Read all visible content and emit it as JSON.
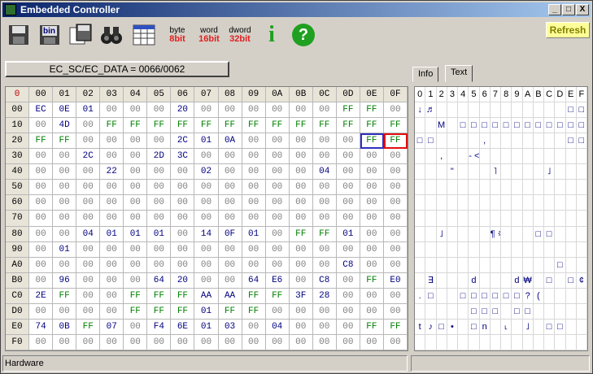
{
  "window": {
    "title": "Embedded Controller",
    "min": "_",
    "max": "□",
    "close": "X"
  },
  "toolbar": {
    "bin": "bin",
    "byte": {
      "top": "byte",
      "bottom": "8bit"
    },
    "word": {
      "top": "word",
      "bottom": "16bit"
    },
    "dword": {
      "top": "dword",
      "bottom": "32bit"
    },
    "info": "i",
    "help": "?",
    "refresh": "Refresh",
    "colors": {
      "byte": "#e02020",
      "word": "#e02020",
      "dword": "#e02020",
      "info": "#20a020",
      "help": "#20a020"
    }
  },
  "ec_label": "EC_SC/EC_DATA = 0066/0062",
  "hex": {
    "corner": "0",
    "cols": [
      "00",
      "01",
      "02",
      "03",
      "04",
      "05",
      "06",
      "07",
      "08",
      "09",
      "0A",
      "0B",
      "0C",
      "0D",
      "0E",
      "0F"
    ],
    "rows": [
      {
        "label": "00",
        "cells": [
          "EC",
          "0E",
          "01",
          "00",
          "00",
          "00",
          "20",
          "00",
          "00",
          "00",
          "00",
          "00",
          "00",
          "FF",
          "FF",
          "00"
        ]
      },
      {
        "label": "10",
        "cells": [
          "00",
          "4D",
          "00",
          "FF",
          "FF",
          "FF",
          "FF",
          "FF",
          "FF",
          "FF",
          "FF",
          "FF",
          "FF",
          "FF",
          "FF",
          "FF"
        ]
      },
      {
        "label": "20",
        "cells": [
          "FF",
          "FF",
          "00",
          "00",
          "00",
          "00",
          "2C",
          "01",
          "0A",
          "00",
          "00",
          "00",
          "00",
          "00",
          "FF",
          "FF"
        ]
      },
      {
        "label": "30",
        "cells": [
          "00",
          "00",
          "2C",
          "00",
          "00",
          "2D",
          "3C",
          "00",
          "00",
          "00",
          "00",
          "00",
          "00",
          "00",
          "00",
          "00"
        ]
      },
      {
        "label": "40",
        "cells": [
          "00",
          "00",
          "00",
          "22",
          "00",
          "00",
          "00",
          "02",
          "00",
          "00",
          "00",
          "00",
          "04",
          "00",
          "00",
          "00"
        ]
      },
      {
        "label": "50",
        "cells": [
          "00",
          "00",
          "00",
          "00",
          "00",
          "00",
          "00",
          "00",
          "00",
          "00",
          "00",
          "00",
          "00",
          "00",
          "00",
          "00"
        ]
      },
      {
        "label": "60",
        "cells": [
          "00",
          "00",
          "00",
          "00",
          "00",
          "00",
          "00",
          "00",
          "00",
          "00",
          "00",
          "00",
          "00",
          "00",
          "00",
          "00"
        ]
      },
      {
        "label": "70",
        "cells": [
          "00",
          "00",
          "00",
          "00",
          "00",
          "00",
          "00",
          "00",
          "00",
          "00",
          "00",
          "00",
          "00",
          "00",
          "00",
          "00"
        ]
      },
      {
        "label": "80",
        "cells": [
          "00",
          "00",
          "04",
          "01",
          "01",
          "01",
          "00",
          "14",
          "0F",
          "01",
          "00",
          "FF",
          "FF",
          "01",
          "00",
          "00"
        ]
      },
      {
        "label": "90",
        "cells": [
          "00",
          "01",
          "00",
          "00",
          "00",
          "00",
          "00",
          "00",
          "00",
          "00",
          "00",
          "00",
          "00",
          "00",
          "00",
          "00"
        ]
      },
      {
        "label": "A0",
        "cells": [
          "00",
          "00",
          "00",
          "00",
          "00",
          "00",
          "00",
          "00",
          "00",
          "00",
          "00",
          "00",
          "00",
          "C8",
          "00",
          "00"
        ]
      },
      {
        "label": "B0",
        "cells": [
          "00",
          "96",
          "00",
          "00",
          "00",
          "64",
          "20",
          "00",
          "00",
          "64",
          "E6",
          "00",
          "C8",
          "00",
          "FF",
          "E0"
        ]
      },
      {
        "label": "C0",
        "cells": [
          "2E",
          "FF",
          "00",
          "00",
          "FF",
          "FF",
          "FF",
          "AA",
          "AA",
          "FF",
          "FF",
          "3F",
          "28",
          "00",
          "00",
          "00"
        ]
      },
      {
        "label": "D0",
        "cells": [
          "00",
          "00",
          "00",
          "00",
          "FF",
          "FF",
          "FF",
          "01",
          "FF",
          "FF",
          "00",
          "00",
          "00",
          "00",
          "00",
          "00"
        ]
      },
      {
        "label": "E0",
        "cells": [
          "74",
          "0B",
          "FF",
          "07",
          "00",
          "F4",
          "6E",
          "01",
          "03",
          "00",
          "04",
          "00",
          "00",
          "00",
          "FF",
          "FF"
        ]
      },
      {
        "label": "F0",
        "cells": [
          "00",
          "00",
          "00",
          "00",
          "00",
          "00",
          "00",
          "00",
          "00",
          "00",
          "00",
          "00",
          "00",
          "00",
          "00",
          "00"
        ]
      }
    ]
  },
  "tabs": [
    {
      "label": "Info"
    },
    {
      "label": "Text"
    }
  ],
  "text": {
    "cols": [
      "0",
      "1",
      "2",
      "3",
      "4",
      "5",
      "6",
      "7",
      "8",
      "9",
      "A",
      "B",
      "C",
      "D",
      "E",
      "F"
    ],
    "rows": [
      [
        "↓",
        "♬",
        "",
        "",
        "",
        "",
        "",
        "",
        "",
        "",
        "",
        "",
        "",
        "",
        "□",
        "□"
      ],
      [
        "",
        "",
        "M",
        "",
        "□",
        "□",
        "□",
        "□",
        "□",
        "□",
        "□",
        "□",
        "□",
        "□",
        "□",
        "□"
      ],
      [
        "□",
        "□",
        "",
        "",
        "",
        "",
        "",
        "",
        "",
        "",
        "",
        "",
        "",
        "",
        "□",
        "□"
      ],
      [
        "",
        "",
        "",
        "",
        "",
        "",
        "",
        "",
        "",
        "",
        "",
        "",
        "",
        "",
        "",
        ""
      ],
      [
        "",
        "",
        "",
        "",
        "",
        "",
        "",
        "",
        "",
        "",
        "",
        "",
        "",
        "",
        "",
        ""
      ],
      [
        "",
        "",
        "",
        "",
        "",
        "",
        "",
        "",
        "",
        "",
        "",
        "",
        "",
        "",
        "",
        ""
      ],
      [
        "",
        "",
        "",
        "",
        "",
        "",
        "",
        "",
        "",
        "",
        "",
        "",
        "",
        "",
        "",
        ""
      ],
      [
        "",
        "",
        "",
        "",
        "",
        "",
        "",
        "",
        "",
        "",
        "",
        "",
        "",
        "",
        "",
        ""
      ],
      [
        "",
        "",
        "",
        "",
        "",
        "",
        "",
        "",
        "",
        "",
        "",
        "",
        "",
        "",
        "",
        ""
      ],
      [
        "",
        "",
        "",
        "",
        "",
        "",
        "",
        "",
        "",
        "",
        "",
        "",
        "",
        "",
        "",
        ""
      ],
      [
        "",
        "",
        "",
        "",
        "",
        "",
        "",
        "",
        "",
        "",
        "",
        "",
        "",
        "",
        "",
        ""
      ],
      [
        "",
        "",
        "",
        "",
        "",
        "",
        "",
        "",
        "",
        "",
        "",
        "",
        "",
        "",
        "",
        ""
      ],
      [
        "",
        "",
        "",
        "",
        "",
        "",
        "",
        "",
        "",
        "",
        "",
        "",
        "",
        "",
        "",
        ""
      ],
      [
        "",
        "",
        "",
        "",
        "",
        "",
        "",
        "",
        "",
        "",
        "",
        "",
        "",
        "",
        "",
        ""
      ],
      [
        "",
        "",
        "",
        "",
        "",
        "",
        "",
        "",
        "",
        "",
        "",
        "",
        "",
        "",
        "",
        ""
      ],
      [
        "",
        "",
        "",
        "",
        "",
        "",
        "",
        "",
        "",
        "",
        "",
        "",
        "",
        "",
        "",
        ""
      ]
    ],
    "overlay": [
      {
        "r": 2,
        "c": 6,
        "ch": ","
      },
      {
        "r": 3,
        "c": 2,
        "ch": ","
      },
      {
        "r": 3,
        "c": 5,
        "ch": "- <"
      },
      {
        "r": 4,
        "c": 3,
        "ch": "\""
      },
      {
        "r": 4,
        "c": 7,
        "ch": "˥"
      },
      {
        "r": 4,
        "c": 12,
        "ch": "˩"
      },
      {
        "r": 8,
        "c": 2,
        "ch": "˩"
      },
      {
        "r": 8,
        "c": 7,
        "ch": "¶ ※"
      },
      {
        "r": 8,
        "c": 11,
        "ch": "□"
      },
      {
        "r": 8,
        "c": 12,
        "ch": "□"
      },
      {
        "r": 10,
        "c": 13,
        "ch": "□"
      },
      {
        "r": 11,
        "c": 1,
        "ch": "∃"
      },
      {
        "r": 11,
        "c": 5,
        "ch": "d"
      },
      {
        "r": 11,
        "c": 9,
        "ch": "d"
      },
      {
        "r": 11,
        "c": 10,
        "ch": "₩"
      },
      {
        "r": 11,
        "c": 12,
        "ch": "□"
      },
      {
        "r": 11,
        "c": 14,
        "ch": "□"
      },
      {
        "r": 11,
        "c": 15,
        "ch": "¢"
      },
      {
        "r": 12,
        "c": 0,
        "ch": "."
      },
      {
        "r": 12,
        "c": 1,
        "ch": "□"
      },
      {
        "r": 12,
        "c": 4,
        "ch": "□"
      },
      {
        "r": 12,
        "c": 5,
        "ch": "□"
      },
      {
        "r": 12,
        "c": 6,
        "ch": "□"
      },
      {
        "r": 12,
        "c": 7,
        "ch": "□"
      },
      {
        "r": 12,
        "c": 8,
        "ch": "□"
      },
      {
        "r": 12,
        "c": 9,
        "ch": "□"
      },
      {
        "r": 12,
        "c": 10,
        "ch": "?"
      },
      {
        "r": 12,
        "c": 11,
        "ch": "("
      },
      {
        "r": 13,
        "c": 5,
        "ch": "□"
      },
      {
        "r": 13,
        "c": 6,
        "ch": "□"
      },
      {
        "r": 13,
        "c": 7,
        "ch": "□"
      },
      {
        "r": 13,
        "c": 9,
        "ch": "□"
      },
      {
        "r": 13,
        "c": 10,
        "ch": "□"
      },
      {
        "r": 14,
        "c": 0,
        "ch": "t"
      },
      {
        "r": 14,
        "c": 1,
        "ch": "♪"
      },
      {
        "r": 14,
        "c": 2,
        "ch": "□"
      },
      {
        "r": 14,
        "c": 3,
        "ch": "•"
      },
      {
        "r": 14,
        "c": 5,
        "ch": "□"
      },
      {
        "r": 14,
        "c": 6,
        "ch": "n"
      },
      {
        "r": 14,
        "c": 8,
        "ch": "˪"
      },
      {
        "r": 14,
        "c": 10,
        "ch": "˩"
      },
      {
        "r": 14,
        "c": 12,
        "ch": "□"
      },
      {
        "r": 14,
        "c": 13,
        "ch": "□"
      }
    ]
  },
  "status": {
    "left": "Hardware"
  }
}
